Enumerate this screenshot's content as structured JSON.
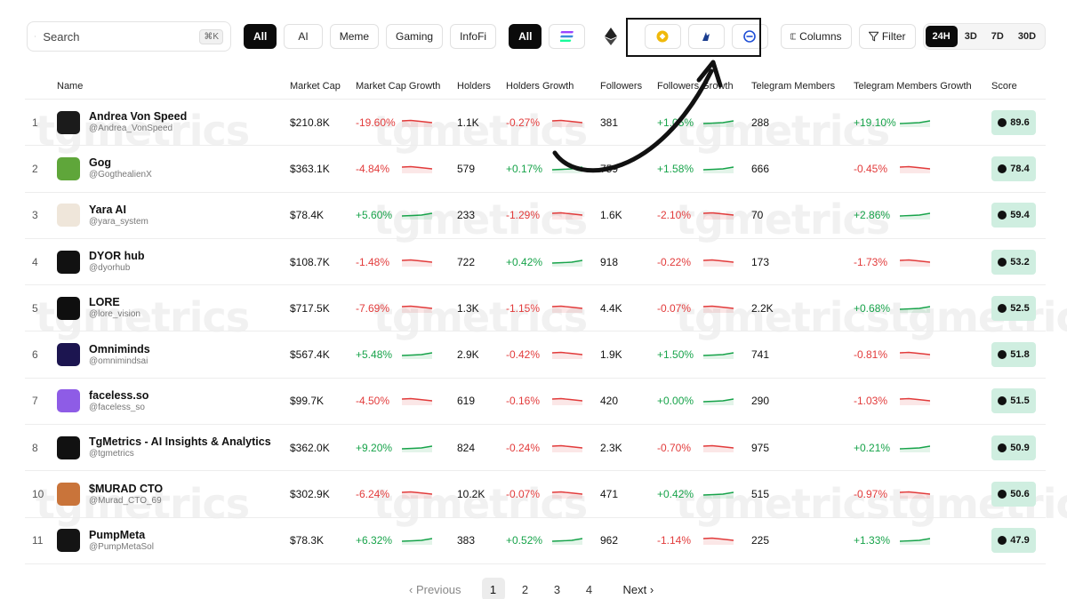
{
  "search": {
    "placeholder": "Search",
    "shortcut": "⌘K"
  },
  "category_filters": [
    "All",
    "AI",
    "Meme",
    "Gaming",
    "InfoFi"
  ],
  "chain_filters": {
    "all_label": "All",
    "chains": [
      "solana-icon",
      "ethereum-icon",
      "bnb-icon",
      "base-icon",
      "other-chain-icon"
    ]
  },
  "buttons": {
    "columns": "Columns",
    "filter": "Filter"
  },
  "timeframes": [
    "24H",
    "3D",
    "7D",
    "30D"
  ],
  "columns": {
    "name": "Name",
    "market_cap": "Market Cap",
    "market_cap_growth": "Market Cap Growth",
    "holders": "Holders",
    "holders_growth": "Holders Growth",
    "followers": "Followers",
    "followers_growth": "Followers Growth",
    "telegram_members": "Telegram Members",
    "telegram_members_growth": "Telegram Members Growth",
    "score": "Score"
  },
  "rows": [
    {
      "rank": "1",
      "name": "Andrea Von Speed",
      "handle": "@Andrea_VonSpeed",
      "market_cap": "$210.8K",
      "mcg": "-19.60%",
      "holders": "1.1K",
      "hg": "-0.27%",
      "followers": "381",
      "fg": "+1.05%",
      "tm": "288",
      "tmg": "+19.10%",
      "score": "89.6",
      "avatar_color": "#1b1b1b"
    },
    {
      "rank": "2",
      "name": "Gog",
      "handle": "@GogthealienX",
      "market_cap": "$363.1K",
      "mcg": "-4.84%",
      "holders": "579",
      "hg": "+0.17%",
      "followers": "759",
      "fg": "+1.58%",
      "tm": "666",
      "tmg": "-0.45%",
      "score": "78.4",
      "avatar_color": "#5fa63a"
    },
    {
      "rank": "3",
      "name": "Yara AI",
      "handle": "@yara_system",
      "market_cap": "$78.4K",
      "mcg": "+5.60%",
      "holders": "233",
      "hg": "-1.29%",
      "followers": "1.6K",
      "fg": "-2.10%",
      "tm": "70",
      "tmg": "+2.86%",
      "score": "59.4",
      "avatar_color": "#efe6da"
    },
    {
      "rank": "4",
      "name": "DYOR hub",
      "handle": "@dyorhub",
      "market_cap": "$108.7K",
      "mcg": "-1.48%",
      "holders": "722",
      "hg": "+0.42%",
      "followers": "918",
      "fg": "-0.22%",
      "tm": "173",
      "tmg": "-1.73%",
      "score": "53.2",
      "avatar_color": "#111111"
    },
    {
      "rank": "5",
      "name": "LORE",
      "handle": "@lore_vision",
      "market_cap": "$717.5K",
      "mcg": "-7.69%",
      "holders": "1.3K",
      "hg": "-1.15%",
      "followers": "4.4K",
      "fg": "-0.07%",
      "tm": "2.2K",
      "tmg": "+0.68%",
      "score": "52.5",
      "avatar_color": "#0f0f0f"
    },
    {
      "rank": "6",
      "name": "Omniminds",
      "handle": "@omnimindsai",
      "market_cap": "$567.4K",
      "mcg": "+5.48%",
      "holders": "2.9K",
      "hg": "-0.42%",
      "followers": "1.9K",
      "fg": "+1.50%",
      "tm": "741",
      "tmg": "-0.81%",
      "score": "51.8",
      "avatar_color": "#1c1550"
    },
    {
      "rank": "7",
      "name": "faceless.so",
      "handle": "@faceless_so",
      "market_cap": "$99.7K",
      "mcg": "-4.50%",
      "holders": "619",
      "hg": "-0.16%",
      "followers": "420",
      "fg": "+0.00%",
      "tm": "290",
      "tmg": "-1.03%",
      "score": "51.5",
      "avatar_color": "#8e5ce6"
    },
    {
      "rank": "8",
      "name": "TgMetrics - AI Insights & Analytics",
      "handle": "@tgmetrics",
      "market_cap": "$362.0K",
      "mcg": "+9.20%",
      "holders": "824",
      "hg": "-0.24%",
      "followers": "2.3K",
      "fg": "-0.70%",
      "tm": "975",
      "tmg": "+0.21%",
      "score": "50.9",
      "avatar_color": "#111111"
    },
    {
      "rank": "10",
      "name": "$MURAD CTO",
      "handle": "@Murad_CTO_69",
      "market_cap": "$302.9K",
      "mcg": "-6.24%",
      "holders": "10.2K",
      "hg": "-0.07%",
      "followers": "471",
      "fg": "+0.42%",
      "tm": "515",
      "tmg": "-0.97%",
      "score": "50.6",
      "avatar_color": "#c9743a"
    },
    {
      "rank": "11",
      "name": "PumpMeta",
      "handle": "@PumpMetaSol",
      "market_cap": "$78.3K",
      "mcg": "+6.32%",
      "holders": "383",
      "hg": "+0.52%",
      "followers": "962",
      "fg": "-1.14%",
      "tm": "225",
      "tmg": "+1.33%",
      "score": "47.9",
      "avatar_color": "#141414"
    }
  ],
  "pagination": {
    "previous": "Previous",
    "pages": [
      "1",
      "2",
      "3",
      "4"
    ],
    "current": "1",
    "next": "Next"
  },
  "watermark": "tgmetrics",
  "colors": {
    "positive": "#17a34a",
    "negative": "#e23b3b",
    "score_bg": "#cfeee0",
    "active": "#0b0b0b"
  }
}
